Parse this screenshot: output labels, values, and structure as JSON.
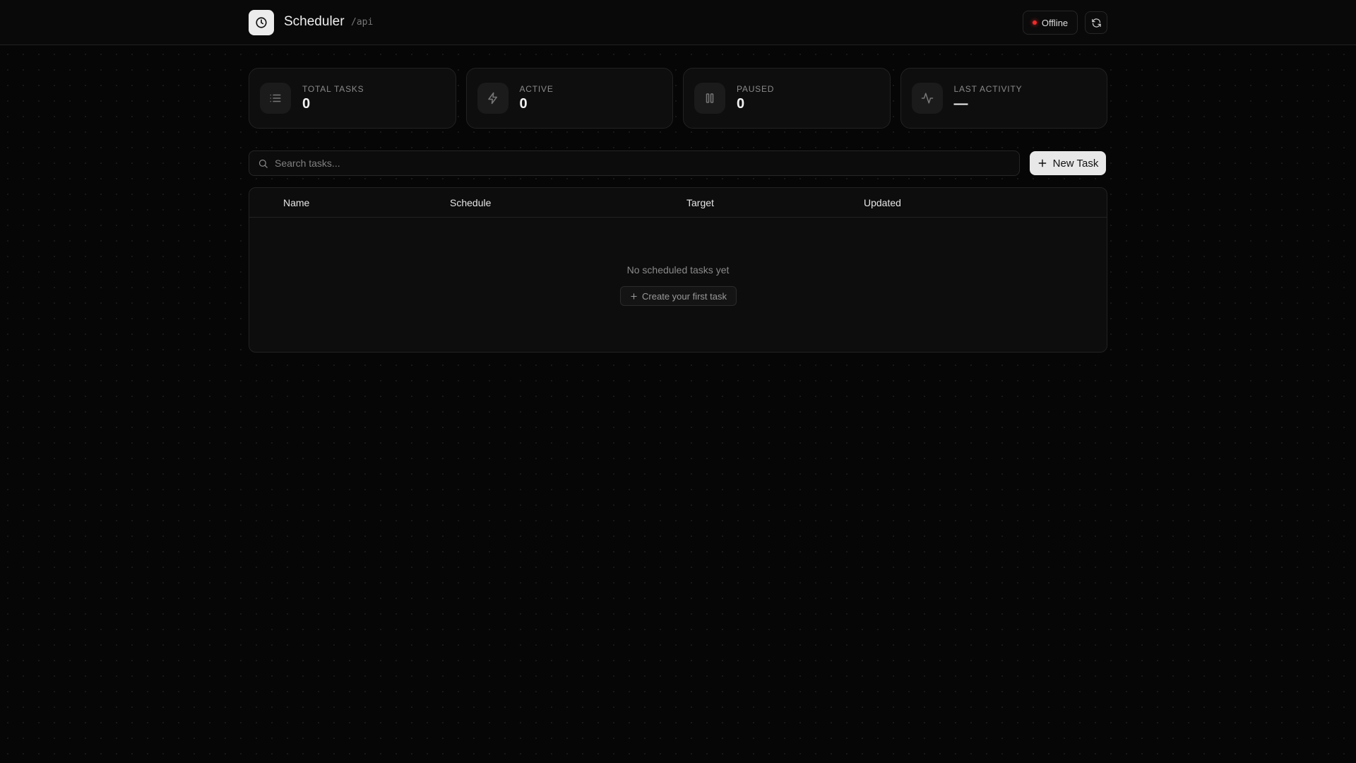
{
  "header": {
    "title": "Scheduler",
    "path": "/api",
    "status": "Offline",
    "status_color": "#ef2b2b"
  },
  "stats": [
    {
      "label": "TOTAL TASKS",
      "value": "0",
      "icon": "list-icon"
    },
    {
      "label": "ACTIVE",
      "value": "0",
      "icon": "zap-icon"
    },
    {
      "label": "PAUSED",
      "value": "0",
      "icon": "pause-icon"
    },
    {
      "label": "LAST ACTIVITY",
      "value": "—",
      "icon": "activity-icon"
    }
  ],
  "search": {
    "placeholder": "Search tasks..."
  },
  "toolbar": {
    "new_task": "New Task"
  },
  "table": {
    "columns": [
      "Name",
      "Schedule",
      "Target",
      "Updated"
    ],
    "empty_text": "No scheduled tasks yet",
    "create_label": "Create your first task"
  }
}
